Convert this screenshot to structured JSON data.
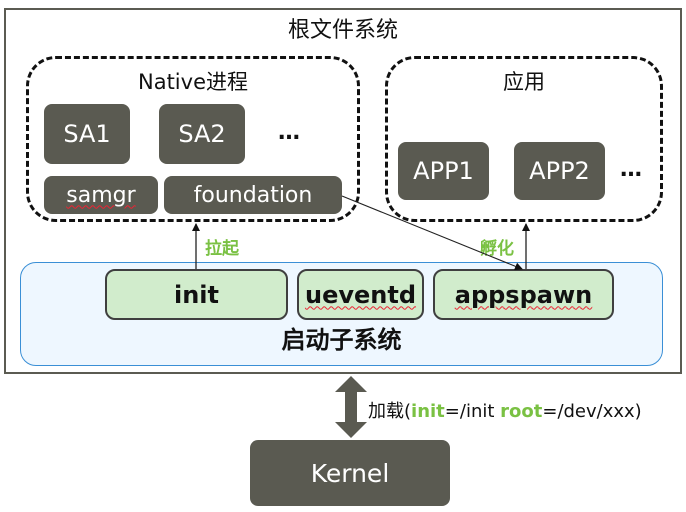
{
  "diagram": {
    "root_fs": {
      "title": "根文件系统"
    },
    "native_group": {
      "title": "Native进程",
      "services": [
        "SA1",
        "SA2"
      ],
      "more": "…",
      "base_components": [
        "samgr",
        "foundation"
      ]
    },
    "app_group": {
      "title": "应用",
      "apps": [
        "APP1",
        "APP2"
      ],
      "more": "…"
    },
    "boot_subsystem": {
      "title": "启动子系统",
      "components": [
        "init",
        "ueventd",
        "appspawn"
      ]
    },
    "edges": {
      "launch_label": "拉起",
      "incubate_label": "孵化"
    },
    "kernel": {
      "label": "Kernel",
      "load": {
        "prefix": "加载(",
        "key1": "init",
        "val1": "=/init ",
        "key2": "root",
        "val2": "=/dev/xxx)"
      }
    },
    "colors": {
      "dark_box": "#5a5a51",
      "green_box": "#d1eccc",
      "highlight_green": "#7ac143",
      "boot_border": "#3a8fd6",
      "boot_fill": "#eef7ff"
    }
  }
}
